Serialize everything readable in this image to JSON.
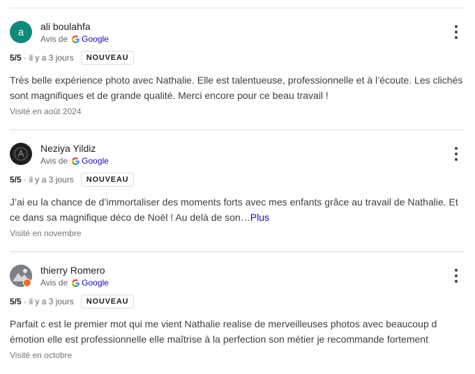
{
  "google_label": "Google",
  "reviews": [
    {
      "avatar_letter": "a",
      "name": "ali boulahfa",
      "source_prefix": "Avis de",
      "rating": "5/5",
      "separator": "·",
      "time_ago": "il y a 3 jours",
      "badge": "NOUVEAU",
      "text": "Très belle expérience photo avec Nathalie. Elle est talentueuse, professionnelle et à l’écoute. Les clichés sont magnifiques et de grande qualité. Merci encore pour ce beau travail !",
      "more_label": "",
      "visited": "Visité en août 2024"
    },
    {
      "name": "Neziya Yildiz",
      "source_prefix": "Avis de",
      "rating": "5/5",
      "separator": "·",
      "time_ago": "il y a 3 jours",
      "badge": "NOUVEAU",
      "text": "J’ai eu la chance de d’immortaliser des moments forts avec mes enfants grâce au travail de Nathalie. Et ce dans sa magnifique déco de Noël ! Au delà de son…",
      "more_label": "Plus",
      "visited": "Visité en novembre"
    },
    {
      "name": "thierry Romero",
      "source_prefix": "Avis de",
      "rating": "5/5",
      "separator": "·",
      "time_ago": "il y a 3 jours",
      "badge": "NOUVEAU",
      "text": "Parfait c est le premier mot qui me vient Nathalie realise de merveilleuses photos avec beaucoup d émotion elle est professionnelle elle maîtrise à la perfection son métier je recommande fortement",
      "more_label": "",
      "visited": "Visité en octobre"
    }
  ],
  "colors": {
    "avatar_teal": "#0f8a79",
    "link_blue": "#1a0dab",
    "divider": "#dadce0",
    "local_guide_badge": "#ea6c2a"
  },
  "icons": [
    "google-g-logo",
    "more-vert-icon",
    "local-guide-badge-icon"
  ]
}
